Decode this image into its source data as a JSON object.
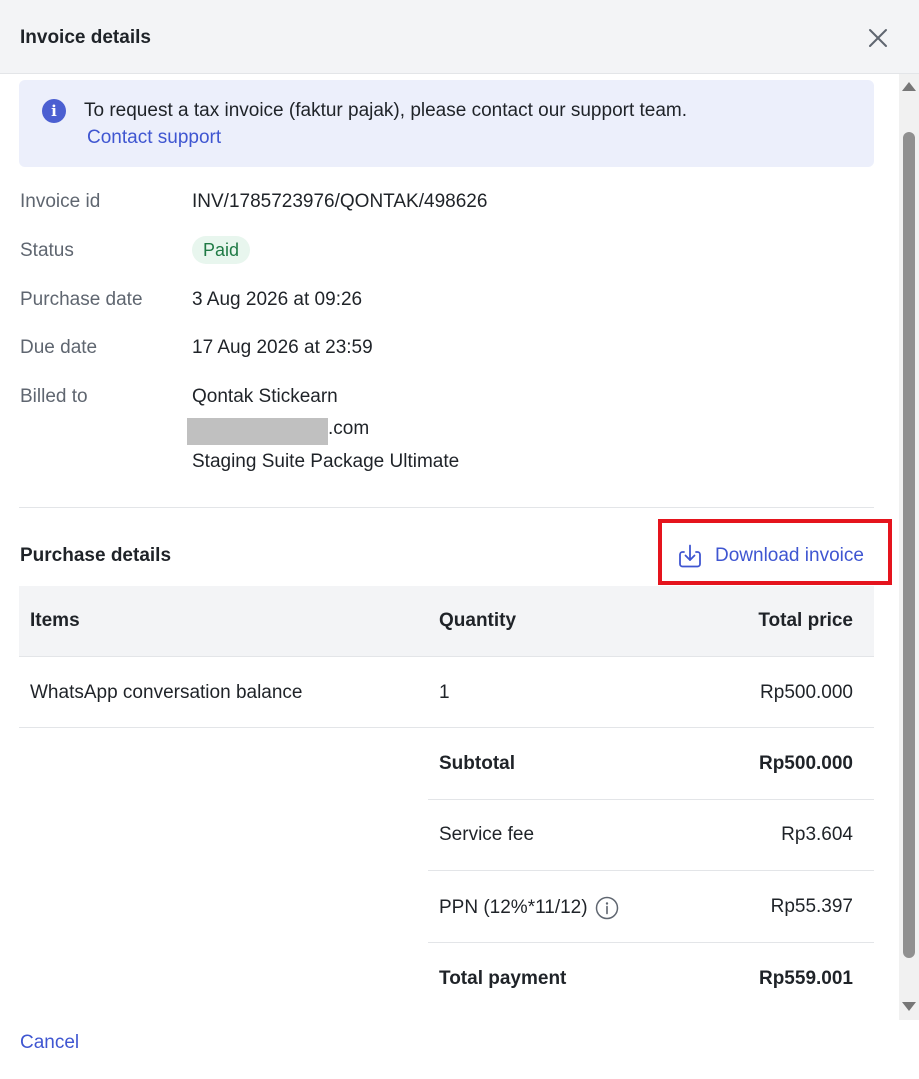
{
  "header": {
    "title": "Invoice details"
  },
  "notice": {
    "text": "To request a tax invoice (faktur pajak), please contact our support team.",
    "link": "Contact support",
    "icon": "i"
  },
  "details": {
    "invoice_id_label": "Invoice id",
    "invoice_id": "INV/1785723976/QONTAK/498626",
    "status_label": "Status",
    "status": "Paid",
    "purchase_date_label": "Purchase date",
    "purchase_date": "3 Aug 2026 at 09:26",
    "due_date_label": "Due date",
    "due_date": "17 Aug 2026 at 23:59",
    "billed_to_label": "Billed to",
    "billed_name": "Qontak Stickearn",
    "billed_email_suffix": ".com",
    "billed_package": "Staging Suite Package Ultimate"
  },
  "purchase": {
    "title": "Purchase details",
    "download_label": "Download invoice",
    "columns": {
      "items": "Items",
      "quantity": "Quantity",
      "total_price": "Total price"
    },
    "rows": [
      {
        "item": "WhatsApp conversation balance",
        "quantity": "1",
        "price": "Rp500.000"
      }
    ],
    "summary": {
      "subtotal_label": "Subtotal",
      "subtotal": "Rp500.000",
      "service_fee_label": "Service fee",
      "service_fee": "Rp3.604",
      "ppn_label": "PPN (12%*11/12)",
      "ppn": "Rp55.397",
      "total_label": "Total payment",
      "total": "Rp559.001"
    }
  },
  "footer": {
    "cancel_label": "Cancel"
  },
  "colors": {
    "accent": "#3f56d1",
    "info_bg": "#eceffb",
    "paid_bg": "#e8f6ee",
    "paid_text": "#1f7a45",
    "highlight": "#e5141d"
  },
  "icons": [
    "close-icon",
    "info-icon",
    "download-icon",
    "ppn-info-icon",
    "scroll-up-arrow",
    "scroll-down-arrow"
  ]
}
